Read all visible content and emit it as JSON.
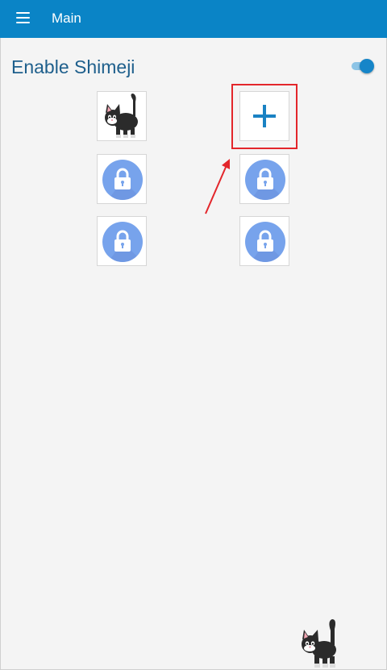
{
  "app_bar": {
    "title": "Main",
    "menu_icon": "hamburger-menu-icon"
  },
  "settings": {
    "enable_label": "Enable Shimeji",
    "enabled": true
  },
  "shimeji_grid": [
    {
      "type": "character",
      "icon": "black-cat-icon"
    },
    {
      "type": "add",
      "icon": "plus-icon"
    },
    {
      "type": "locked",
      "icon": "lock-icon"
    },
    {
      "type": "locked",
      "icon": "lock-icon"
    },
    {
      "type": "locked",
      "icon": "lock-icon"
    },
    {
      "type": "locked",
      "icon": "lock-icon"
    }
  ],
  "colors": {
    "app_bar": "#0a84c6",
    "label_text": "#1e5f8c",
    "toggle_thumb": "#1685c8",
    "lock_circle": "#77a3ec",
    "add_plus": "#1a82c3",
    "annotation": "#e3262b"
  }
}
